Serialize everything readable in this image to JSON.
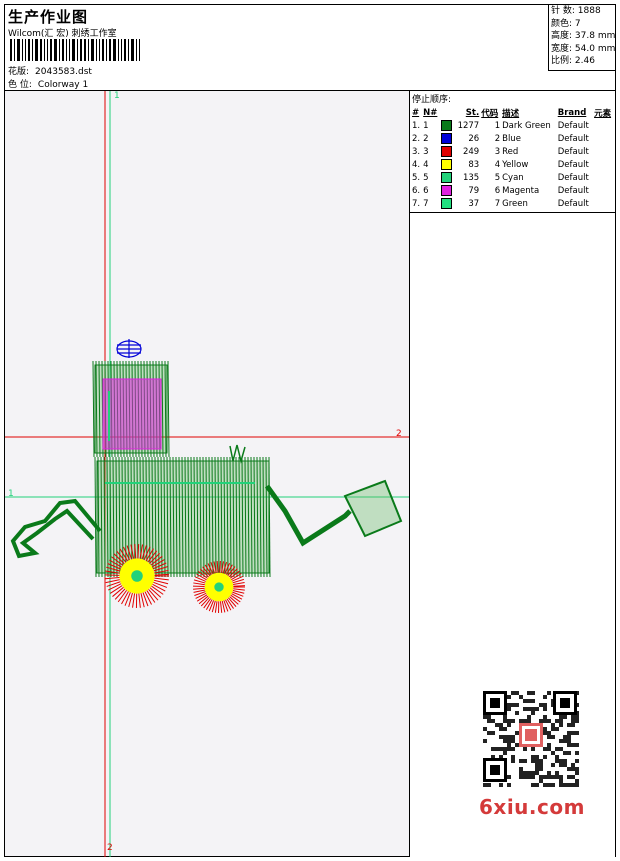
{
  "header": {
    "title": "生产作业图",
    "studio": "Wilcom(汇 宏) 刺绣工作室",
    "pattern_label": "花版:",
    "pattern_value": "2043583.dst",
    "colorway_label": "色 位:",
    "colorway_value": "Colorway 1"
  },
  "stats": [
    {
      "label": "针 数:",
      "value": "1888"
    },
    {
      "label": "颜色:",
      "value": "7"
    },
    {
      "label": "高度:",
      "value": "37.8 mm"
    },
    {
      "label": "宽度:",
      "value": "54.0 mm"
    },
    {
      "label": "比例:",
      "value": "2.46"
    }
  ],
  "stop_sequence": {
    "title": "停止顺序:",
    "columns": [
      "#",
      "N#",
      "St.",
      "代码",
      "描述",
      "Brand",
      "元素"
    ],
    "rows": [
      {
        "idx": "1.",
        "n": "1",
        "color": "#0a7a1a",
        "st": "1277",
        "code": "1",
        "desc": "Dark Green",
        "brand": "Default"
      },
      {
        "idx": "2.",
        "n": "2",
        "color": "#0000d8",
        "st": "26",
        "code": "2",
        "desc": "Blue",
        "brand": "Default"
      },
      {
        "idx": "3.",
        "n": "3",
        "color": "#e00000",
        "st": "249",
        "code": "3",
        "desc": "Red",
        "brand": "Default"
      },
      {
        "idx": "4.",
        "n": "4",
        "color": "#ffff00",
        "st": "83",
        "code": "4",
        "desc": "Yellow",
        "brand": "Default"
      },
      {
        "idx": "5.",
        "n": "5",
        "color": "#22d27a",
        "st": "135",
        "code": "5",
        "desc": "Cyan",
        "brand": "Default"
      },
      {
        "idx": "6.",
        "n": "6",
        "color": "#e020e0",
        "st": "79",
        "code": "6",
        "desc": "Magenta",
        "brand": "Default"
      },
      {
        "idx": "7.",
        "n": "7",
        "color": "#22e080",
        "st": "37",
        "code": "7",
        "desc": "Green",
        "brand": "Default"
      }
    ]
  },
  "guides": {
    "v_green": "1",
    "v_red": "2",
    "h_red": "2",
    "h_green": "1"
  },
  "watermark": "6xiu.com",
  "colors": {
    "dark_green": "#0a7a1a",
    "blue": "#0000d8",
    "red": "#e00000",
    "yellow": "#ffff00",
    "cyan": "#22d27a",
    "magenta": "#e020e0",
    "green": "#22e080",
    "guide_red": "#e00000",
    "guide_green": "#22d27a"
  }
}
